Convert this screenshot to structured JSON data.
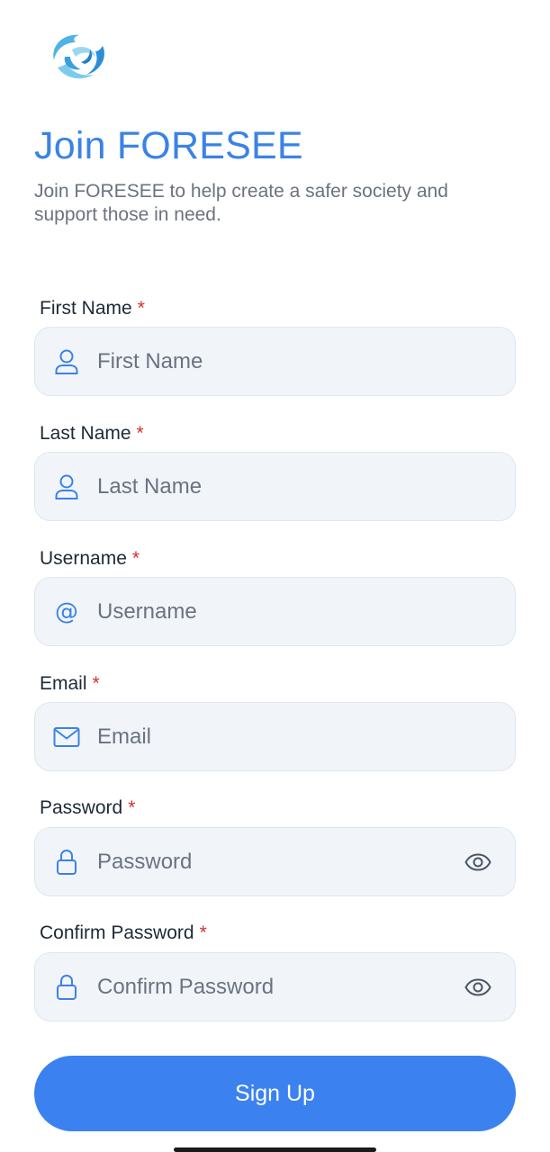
{
  "header": {
    "title": "Join FORESEE",
    "subtitle": "Join FORESEE to help create a safer society and support those in need."
  },
  "form": {
    "required_marker": "*",
    "first_name": {
      "label": "First Name",
      "placeholder": "First Name",
      "icon": "person-icon"
    },
    "last_name": {
      "label": "Last Name",
      "placeholder": "Last Name",
      "icon": "person-icon"
    },
    "username": {
      "label": "Username",
      "placeholder": "Username",
      "icon": "at-icon",
      "icon_glyph": "@"
    },
    "email": {
      "label": "Email",
      "placeholder": "Email",
      "icon": "mail-icon"
    },
    "password": {
      "label": "Password",
      "placeholder": "Password",
      "icon": "lock-icon",
      "toggle_icon": "eye-icon"
    },
    "confirm_password": {
      "label": "Confirm Password",
      "placeholder": "Confirm Password",
      "icon": "lock-icon",
      "toggle_icon": "eye-icon"
    }
  },
  "actions": {
    "signup_label": "Sign Up"
  },
  "colors": {
    "accent": "#3b82e6",
    "button": "#3b82f0",
    "required": "#d32f2f",
    "field_bg": "#f1f5fa",
    "muted_text": "#6b7280"
  }
}
